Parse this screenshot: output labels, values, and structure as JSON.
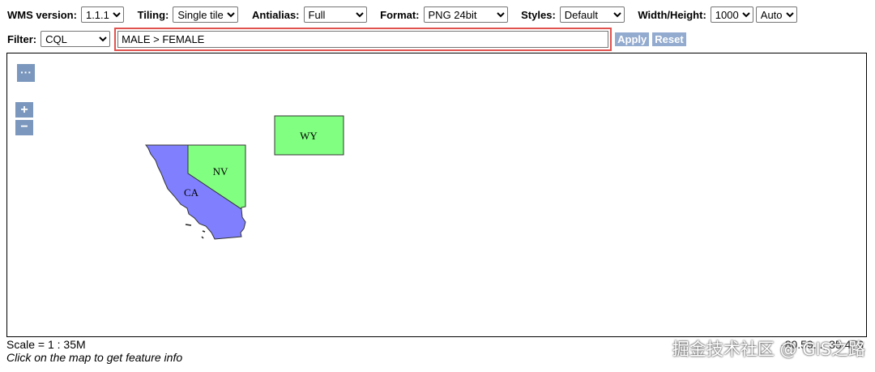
{
  "toolbar": {
    "wms_version": {
      "label": "WMS version:",
      "value": "1.1.1"
    },
    "tiling": {
      "label": "Tiling:",
      "value": "Single tile"
    },
    "antialias": {
      "label": "Antialias:",
      "value": "Full"
    },
    "format": {
      "label": "Format:",
      "value": "PNG 24bit"
    },
    "styles": {
      "label": "Styles:",
      "value": "Default"
    },
    "size": {
      "label": "Width/Height:",
      "width": "1000",
      "height": "Auto"
    }
  },
  "filter": {
    "label": "Filter:",
    "type": "CQL",
    "value": "MALE > FEMALE",
    "apply_label": "Apply",
    "reset_label": "Reset"
  },
  "map": {
    "controls": {
      "more": "···",
      "zoom_in": "+",
      "zoom_out": "−"
    },
    "states": [
      {
        "name": "WY",
        "color": "#80ff80"
      },
      {
        "name": "NV",
        "color": "#80ff80"
      },
      {
        "name": "CA",
        "color": "#8080ff"
      }
    ],
    "coordinates": "-80.59..., 35.473"
  },
  "footer": {
    "scale": "Scale = 1 : 35M",
    "hint": "Click on the map to get feature info"
  },
  "watermark": "掘金技术社区 @ GIS之路"
}
